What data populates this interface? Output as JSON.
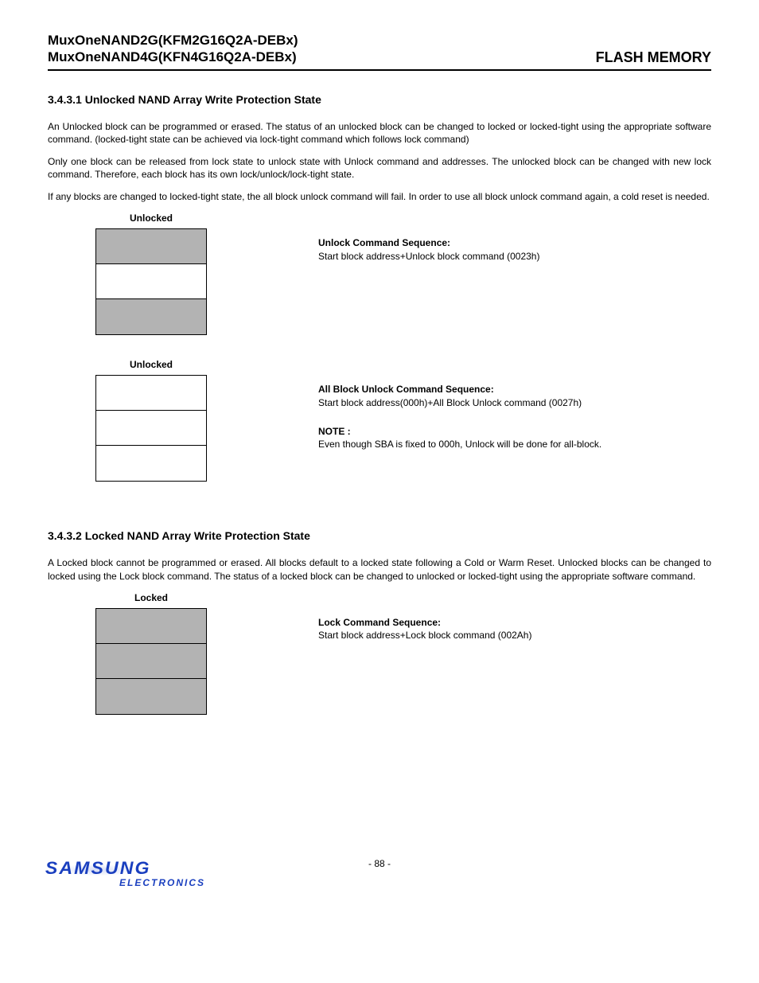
{
  "header": {
    "left_line1": "MuxOneNAND2G(KFM2G16Q2A-DEBx)",
    "left_line2": "MuxOneNAND4G(KFN4G16Q2A-DEBx)",
    "right": "FLASH MEMORY"
  },
  "section1": {
    "heading": "3.4.3.1  Unlocked NAND Array Write Protection State",
    "p1": "An Unlocked block can be programmed or erased. The status of an unlocked block can be changed to locked or locked-tight using the appropriate software command. (locked-tight state can be achieved via lock-tight command which follows lock command)",
    "p2": "Only one block can be released from lock state to unlock state with Unlock command and addresses. The unlocked block can be changed with new lock command. Therefore, each block has its own lock/unlock/lock-tight state.",
    "p3": "If any blocks are changed to locked-tight state, the all block unlock command will fail. In order to use all block unlock command again, a cold reset is needed."
  },
  "fig1": {
    "label": "Unlocked",
    "seq_title": "Unlock Command Sequence:",
    "seq_body": "Start block address+Unlock block command (0023h)"
  },
  "fig2": {
    "label": "Unlocked",
    "seq_title": "All Block Unlock Command Sequence:",
    "seq_body": "Start block address(000h)+All Block Unlock command (0027h)",
    "note_label": "NOTE :",
    "note_body": "Even though SBA is fixed to 000h, Unlock will be done for all-block."
  },
  "section2": {
    "heading": "3.4.3.2 Locked NAND Array Write Protection State",
    "p1": "A Locked block cannot be programmed or erased. All blocks default to a locked state following a Cold or Warm Reset. Unlocked blocks can be changed to locked using the Lock block command. The status of a locked block can be changed to unlocked or locked-tight using the appropriate software command."
  },
  "fig3": {
    "label": "Locked",
    "seq_title": "Lock Command Sequence:",
    "seq_body": "Start block address+Lock block command (002Ah)"
  },
  "footer": {
    "page": "- 88 -",
    "logo_main": "SAMSUNG",
    "logo_sub": "ELECTRONICS"
  }
}
